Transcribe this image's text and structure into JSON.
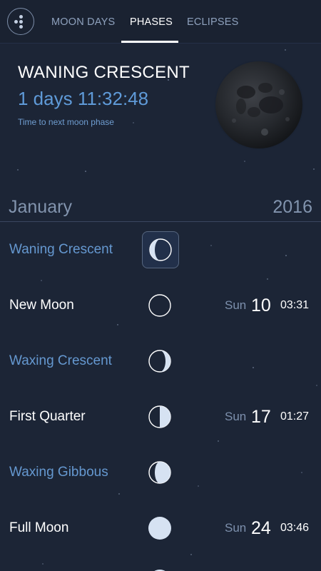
{
  "tabs": [
    {
      "label": "MOON DAYS",
      "active": false
    },
    {
      "label": "PHASES",
      "active": true
    },
    {
      "label": "ECLIPSES",
      "active": false
    }
  ],
  "current": {
    "phase": "WANING CRESCENT",
    "countdown": "1 days 11:32:48",
    "countdown_label": "Time to next moon phase"
  },
  "calendar": {
    "month": "January",
    "year": "2016"
  },
  "phases": [
    {
      "name": "Waning Crescent",
      "icon": "waning-crescent-icon",
      "style": "blue",
      "dow": "",
      "day": "",
      "time": "",
      "selected": true
    },
    {
      "name": "New Moon",
      "icon": "new-moon-icon",
      "style": "white",
      "dow": "Sun",
      "day": "10",
      "time": "03:31",
      "selected": false
    },
    {
      "name": "Waxing Crescent",
      "icon": "waxing-crescent-icon",
      "style": "blue",
      "dow": "",
      "day": "",
      "time": "",
      "selected": false
    },
    {
      "name": "First Quarter",
      "icon": "first-quarter-icon",
      "style": "white",
      "dow": "Sun",
      "day": "17",
      "time": "01:27",
      "selected": false
    },
    {
      "name": "Waxing Gibbous",
      "icon": "waxing-gibbous-icon",
      "style": "blue",
      "dow": "",
      "day": "",
      "time": "",
      "selected": false
    },
    {
      "name": "Full Moon",
      "icon": "full-moon-icon",
      "style": "white",
      "dow": "Sun",
      "day": "24",
      "time": "03:46",
      "selected": false
    }
  ],
  "colors": {
    "background": "#1c2536",
    "accent_blue": "#5f9ad8",
    "text_white": "#ffffff"
  }
}
